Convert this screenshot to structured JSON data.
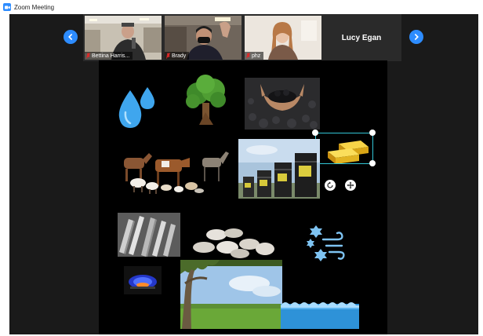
{
  "window": {
    "title": "Zoom Meeting"
  },
  "participants": [
    {
      "name": "Bettina Harris..."
    },
    {
      "name": "Brady"
    },
    {
      "name": "phz"
    },
    {
      "name": "Lucy Egan"
    }
  ],
  "colors": {
    "accent": "#2d8cff",
    "selection": "#32c6d6",
    "mute": "#e02828"
  },
  "icons": [
    "zoom-logo-icon",
    "mic-muted-icon",
    "chevron-left-icon",
    "chevron-right-icon",
    "rotate-icon",
    "move-icon"
  ],
  "shared_screen": {
    "items": [
      "water-drops",
      "tree",
      "coal",
      "gold-bars",
      "livestock",
      "oil-barrels",
      "metal-pipes",
      "stones",
      "wind",
      "natural-gas-flame",
      "field-landscape",
      "water-waves"
    ]
  }
}
